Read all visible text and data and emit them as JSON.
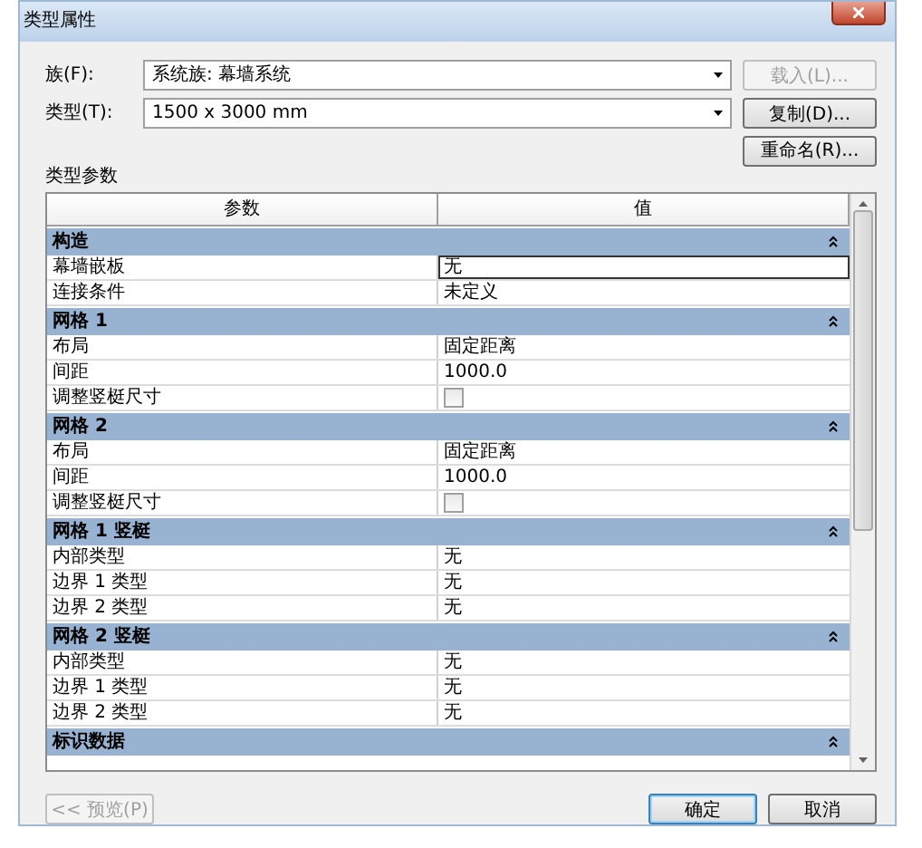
{
  "window": {
    "title": "类型属性"
  },
  "fields": [
    {
      "label": "族(F):",
      "value": "系统族: 幕墙系统",
      "button": {
        "label": "载入(L)...",
        "disabled": true
      }
    },
    {
      "label": "类型(T):",
      "value": "1500 x 3000 mm",
      "button": {
        "label": "复制(D)...",
        "disabled": false
      }
    }
  ],
  "rename_button": {
    "label": "重命名(R)...",
    "disabled": false
  },
  "section_title": "类型参数",
  "table": {
    "columns": [
      "参数",
      "值"
    ],
    "groups": [
      {
        "title": "构造",
        "expanded": true,
        "rows": [
          {
            "kind": "text",
            "param": "幕墙嵌板",
            "value": "无",
            "selected": true
          },
          {
            "kind": "text",
            "param": "连接条件",
            "value": "未定义",
            "selected": false
          }
        ]
      },
      {
        "title": "网格 1",
        "expanded": true,
        "rows": [
          {
            "kind": "text",
            "param": "布局",
            "value": "固定距离",
            "selected": false
          },
          {
            "kind": "text",
            "param": "间距",
            "value": "1000.0",
            "selected": false
          },
          {
            "kind": "checkbox",
            "param": "调整竖梃尺寸",
            "checked": false,
            "selected": false
          }
        ]
      },
      {
        "title": "网格 2",
        "expanded": true,
        "rows": [
          {
            "kind": "text",
            "param": "布局",
            "value": "固定距离",
            "selected": false
          },
          {
            "kind": "text",
            "param": "间距",
            "value": "1000.0",
            "selected": false
          },
          {
            "kind": "checkbox",
            "param": "调整竖梃尺寸",
            "checked": false,
            "selected": false
          }
        ]
      },
      {
        "title": "网格 1 竖梃",
        "expanded": true,
        "rows": [
          {
            "kind": "text",
            "param": "内部类型",
            "value": "无",
            "selected": false
          },
          {
            "kind": "text",
            "param": "边界 1 类型",
            "value": "无",
            "selected": false
          },
          {
            "kind": "text",
            "param": "边界 2 类型",
            "value": "无",
            "selected": false
          }
        ]
      },
      {
        "title": "网格 2 竖梃",
        "expanded": true,
        "rows": [
          {
            "kind": "text",
            "param": "内部类型",
            "value": "无",
            "selected": false
          },
          {
            "kind": "text",
            "param": "边界 1 类型",
            "value": "无",
            "selected": false
          },
          {
            "kind": "text",
            "param": "边界 2 类型",
            "value": "无",
            "selected": false
          }
        ]
      },
      {
        "title": "标识数据",
        "expanded": true
      }
    ]
  },
  "footer": {
    "preview_button": {
      "label": "<< 预览(P)",
      "disabled": true
    },
    "buttons": [
      {
        "label": "确定",
        "default": true
      },
      {
        "label": "取消",
        "default": false
      }
    ]
  }
}
